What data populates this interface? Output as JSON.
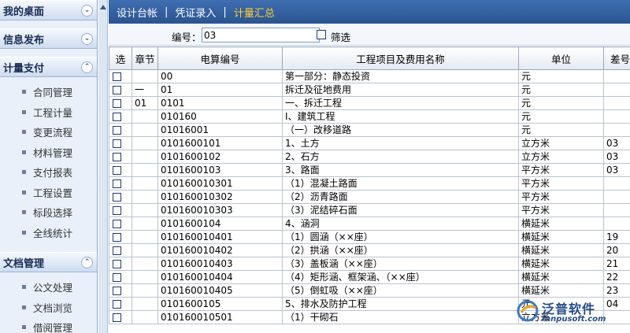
{
  "sidebar": {
    "sections": [
      {
        "title": "我的桌面",
        "state": "collapsed",
        "items": []
      },
      {
        "title": "信息发布",
        "state": "collapsed",
        "items": []
      },
      {
        "title": "计量支付",
        "state": "expanded",
        "items": [
          "合同管理",
          "工程计量",
          "变更流程",
          "材料管理",
          "支付报表",
          "工程设置",
          "标段选择",
          "全线统计"
        ]
      },
      {
        "title": "文档管理",
        "state": "expanded",
        "items": [
          "公文处理",
          "文档浏览",
          "借阅管理"
        ]
      }
    ]
  },
  "tabs": [
    {
      "label": "设计台帐",
      "active": false
    },
    {
      "label": "凭证录入",
      "active": false
    },
    {
      "label": "计量汇总",
      "active": true
    }
  ],
  "filter": {
    "code_label": "编号：",
    "code_value": "03",
    "checkbox_label": "筛选",
    "checkbox_checked": false
  },
  "table": {
    "columns": [
      "选",
      "章节",
      "电算编号",
      "工程项目及费用名称",
      "单位",
      "差号"
    ],
    "rows": [
      {
        "chapter": "",
        "code": "00",
        "name": "第一部分：静态投资",
        "unit": "元",
        "diff": ""
      },
      {
        "chapter": "一",
        "code": "01",
        "name": "拆迁及征地费用",
        "unit": "元",
        "diff": ""
      },
      {
        "chapter": "01",
        "code": "0101",
        "name": "一、拆迁工程",
        "unit": "元",
        "diff": ""
      },
      {
        "chapter": "",
        "code": "010160",
        "name": "I、建筑工程",
        "unit": "元",
        "diff": ""
      },
      {
        "chapter": "",
        "code": "01016001",
        "name": "（一）改移道路",
        "unit": "元",
        "diff": ""
      },
      {
        "chapter": "",
        "code": "0101600101",
        "name": "1、土方",
        "unit": "立方米",
        "diff": "03"
      },
      {
        "chapter": "",
        "code": "0101600102",
        "name": "2、石方",
        "unit": "立方米",
        "diff": "03"
      },
      {
        "chapter": "",
        "code": "0101600103",
        "name": "3、路面",
        "unit": "平方米",
        "diff": "03"
      },
      {
        "chapter": "",
        "code": "010160010301",
        "name": "（1）混凝土路面",
        "unit": "平方米",
        "diff": ""
      },
      {
        "chapter": "",
        "code": "010160010302",
        "name": "（2）沥青路面",
        "unit": "平方米",
        "diff": ""
      },
      {
        "chapter": "",
        "code": "010160010303",
        "name": "（3）泥结碎石面",
        "unit": "平方米",
        "diff": ""
      },
      {
        "chapter": "",
        "code": "0101600104",
        "name": "4、涵洞",
        "unit": "横延米",
        "diff": ""
      },
      {
        "chapter": "",
        "code": "010160010401",
        "name": "（1）圆涵（××座）",
        "unit": "横延米",
        "diff": "19"
      },
      {
        "chapter": "",
        "code": "010160010402",
        "name": "（2）拱涵（××座）",
        "unit": "横延米",
        "diff": "20"
      },
      {
        "chapter": "",
        "code": "010160010403",
        "name": "（3）盖板涵（××座）",
        "unit": "横延米",
        "diff": "21"
      },
      {
        "chapter": "",
        "code": "010160010404",
        "name": "（4）矩形涵、框架涵、（××座）",
        "unit": "横延米",
        "diff": "22"
      },
      {
        "chapter": "",
        "code": "010160010405",
        "name": "（5）倒虹吸（××座）",
        "unit": "横延米",
        "diff": "23"
      },
      {
        "chapter": "",
        "code": "0101600105",
        "name": "5、排水及防护工程",
        "unit": "元",
        "diff": "04"
      },
      {
        "chapter": "",
        "code": "010160010501",
        "name": "（1）干砌石",
        "unit": "立方米",
        "diff": ""
      }
    ]
  },
  "watermark": {
    "name": "泛普软件",
    "url": "fanpusoft.com"
  },
  "colors": {
    "tabbar": "#2f5c9c",
    "active_tab": "#ffcc33",
    "sidebar_bg": "#e9f0fa"
  }
}
